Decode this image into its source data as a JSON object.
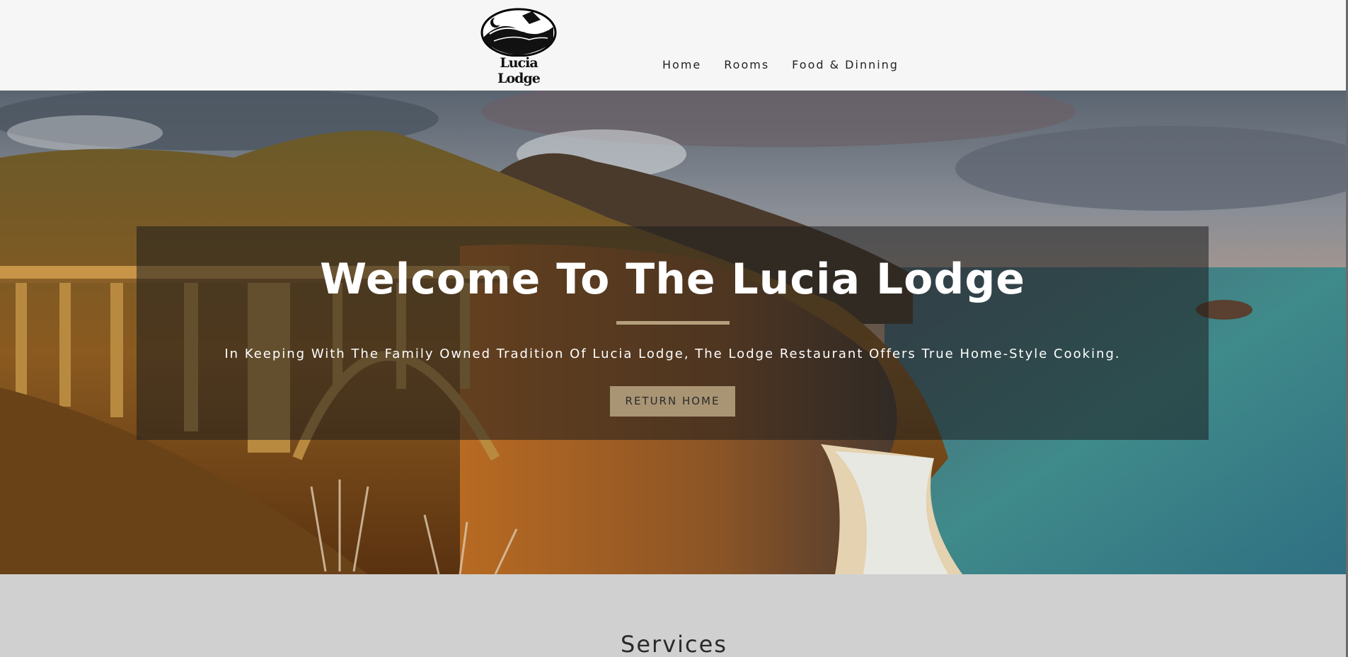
{
  "header": {
    "logo_text": "Lucia Lodge",
    "nav": [
      {
        "label": "Home"
      },
      {
        "label": "Rooms"
      },
      {
        "label": "Food & Dinning"
      }
    ]
  },
  "hero": {
    "title": "Welcome To The Lucia Lodge",
    "subtitle": "In Keeping With The Family Owned Tradition Of Lucia Lodge, The Lodge Restaurant Offers True Home-Style Cooking.",
    "button_label": "RETURN HOME",
    "accent_color": "#a99474"
  },
  "services": {
    "title": "Services"
  }
}
